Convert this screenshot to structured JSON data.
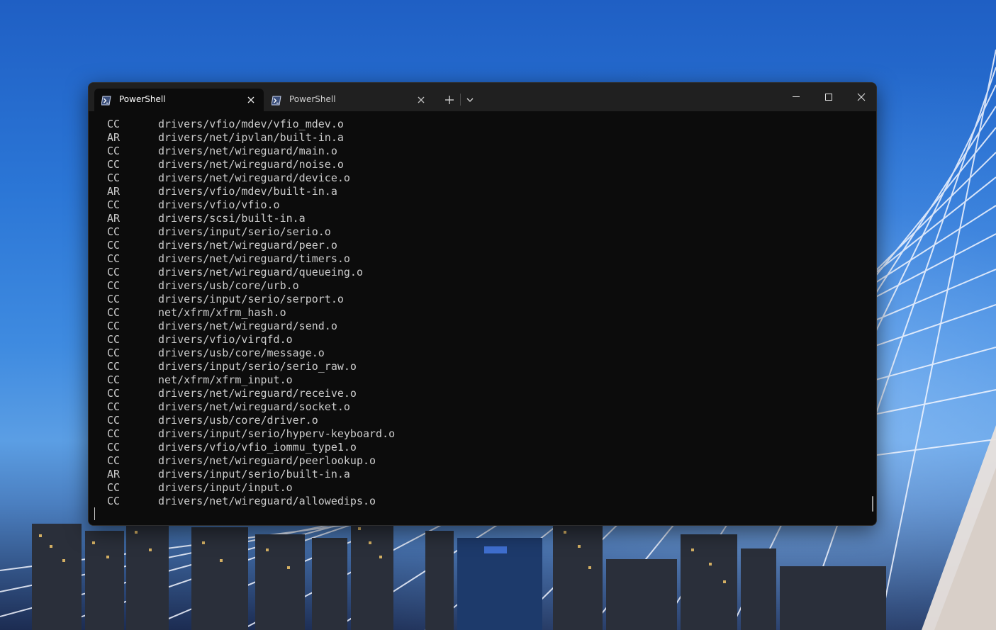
{
  "window": {
    "tabs": [
      {
        "title": "PowerShell",
        "active": true,
        "icon": "powershell-icon"
      },
      {
        "title": "PowerShell",
        "active": false,
        "icon": "powershell-icon"
      }
    ],
    "controls": [
      "new-tab-icon",
      "chevron-down-icon",
      "minimize-icon",
      "maximize-icon",
      "close-icon"
    ]
  },
  "console": {
    "lines": [
      {
        "cmd": "CC",
        "path": "drivers/vfio/mdev/vfio_mdev.o"
      },
      {
        "cmd": "AR",
        "path": "drivers/net/ipvlan/built-in.a"
      },
      {
        "cmd": "CC",
        "path": "drivers/net/wireguard/main.o"
      },
      {
        "cmd": "CC",
        "path": "drivers/net/wireguard/noise.o"
      },
      {
        "cmd": "CC",
        "path": "drivers/net/wireguard/device.o"
      },
      {
        "cmd": "AR",
        "path": "drivers/vfio/mdev/built-in.a"
      },
      {
        "cmd": "CC",
        "path": "drivers/vfio/vfio.o"
      },
      {
        "cmd": "AR",
        "path": "drivers/scsi/built-in.a"
      },
      {
        "cmd": "CC",
        "path": "drivers/input/serio/serio.o"
      },
      {
        "cmd": "CC",
        "path": "drivers/net/wireguard/peer.o"
      },
      {
        "cmd": "CC",
        "path": "drivers/net/wireguard/timers.o"
      },
      {
        "cmd": "CC",
        "path": "drivers/net/wireguard/queueing.o"
      },
      {
        "cmd": "CC",
        "path": "drivers/usb/core/urb.o"
      },
      {
        "cmd": "CC",
        "path": "drivers/input/serio/serport.o"
      },
      {
        "cmd": "CC",
        "path": "net/xfrm/xfrm_hash.o"
      },
      {
        "cmd": "CC",
        "path": "drivers/net/wireguard/send.o"
      },
      {
        "cmd": "CC",
        "path": "drivers/vfio/virqfd.o"
      },
      {
        "cmd": "CC",
        "path": "drivers/usb/core/message.o"
      },
      {
        "cmd": "CC",
        "path": "drivers/input/serio/serio_raw.o"
      },
      {
        "cmd": "CC",
        "path": "net/xfrm/xfrm_input.o"
      },
      {
        "cmd": "CC",
        "path": "drivers/net/wireguard/receive.o"
      },
      {
        "cmd": "CC",
        "path": "drivers/net/wireguard/socket.o"
      },
      {
        "cmd": "CC",
        "path": "drivers/usb/core/driver.o"
      },
      {
        "cmd": "CC",
        "path": "drivers/input/serio/hyperv-keyboard.o"
      },
      {
        "cmd": "CC",
        "path": "drivers/vfio/vfio_iommu_type1.o"
      },
      {
        "cmd": "CC",
        "path": "drivers/net/wireguard/peerlookup.o"
      },
      {
        "cmd": "AR",
        "path": "drivers/input/serio/built-in.a"
      },
      {
        "cmd": "CC",
        "path": "drivers/input/input.o"
      },
      {
        "cmd": "CC",
        "path": "drivers/net/wireguard/allowedips.o"
      }
    ]
  },
  "colors": {
    "console_bg": "#0c0c0c",
    "console_fg": "#cccccc",
    "titlebar_bg": "#202020"
  },
  "wallpaper": "city-skyline-with-cable-bridge"
}
